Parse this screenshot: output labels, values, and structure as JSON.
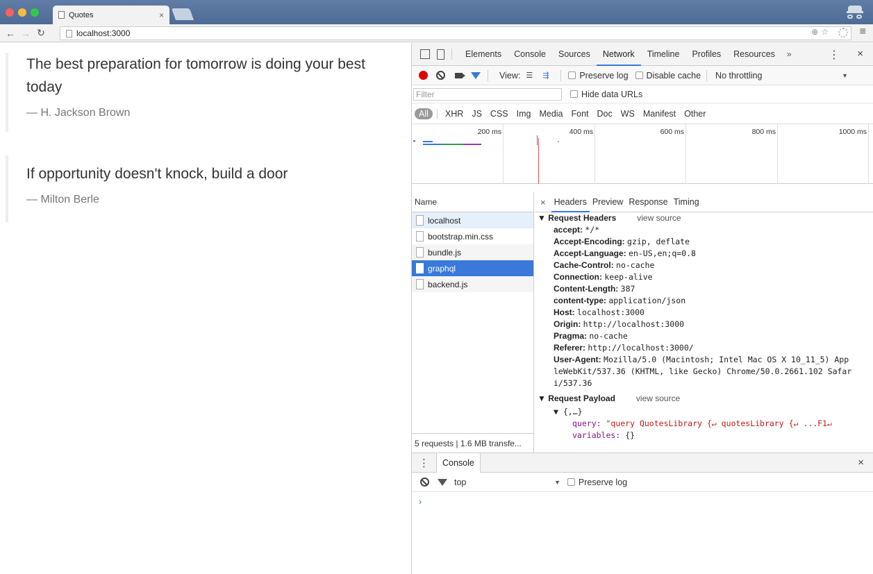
{
  "browser": {
    "tab_title": "Quotes",
    "tab_close": "×",
    "url": "localhost:3000",
    "omnibox_icons": "⊕☆",
    "menu": "≡"
  },
  "page": {
    "quotes": [
      {
        "text": "The best preparation for tomorrow is doing your best today",
        "author": "— H. Jackson Brown"
      },
      {
        "text": "If opportunity doesn't knock, build a door",
        "author": "— Milton Berle"
      }
    ]
  },
  "devtools": {
    "tabs": [
      "Elements",
      "Console",
      "Sources",
      "Network",
      "Timeline",
      "Profiles",
      "Resources"
    ],
    "active_tab": "Network",
    "more": "»",
    "kebab": "⋮",
    "close": "×",
    "network": {
      "view_label": "View:",
      "preserve_log": "Preserve log",
      "disable_cache": "Disable cache",
      "throttling": "No throttling",
      "filter_placeholder": "Filter",
      "hide_data_urls": "Hide data URLs",
      "types": [
        "All",
        "XHR",
        "JS",
        "CSS",
        "Img",
        "Media",
        "Font",
        "Doc",
        "WS",
        "Manifest",
        "Other"
      ],
      "timeline_labels": [
        "200 ms",
        "400 ms",
        "600 ms",
        "800 ms",
        "1000 ms"
      ],
      "name_header": "Name",
      "requests": [
        "localhost",
        "bootstrap.min.css",
        "bundle.js",
        "graphql",
        "backend.js"
      ],
      "selected_request": "graphql",
      "status": "5 requests  |  1.6 MB transfe..."
    },
    "details": {
      "close": "×",
      "tabs": [
        "Headers",
        "Preview",
        "Response",
        "Timing"
      ],
      "active_tab": "Headers",
      "request_headers_title": "▼ Request Headers",
      "view_source": "view source",
      "headers": [
        {
          "k": "accept:",
          "v": "*/*"
        },
        {
          "k": "Accept-Encoding:",
          "v": "gzip, deflate"
        },
        {
          "k": "Accept-Language:",
          "v": "en-US,en;q=0.8"
        },
        {
          "k": "Cache-Control:",
          "v": "no-cache"
        },
        {
          "k": "Connection:",
          "v": "keep-alive"
        },
        {
          "k": "Content-Length:",
          "v": "387"
        },
        {
          "k": "content-type:",
          "v": "application/json"
        },
        {
          "k": "Host:",
          "v": "localhost:3000"
        },
        {
          "k": "Origin:",
          "v": "http://localhost:3000"
        },
        {
          "k": "Pragma:",
          "v": "no-cache"
        },
        {
          "k": "Referer:",
          "v": "http://localhost:3000/"
        },
        {
          "k": "User-Agent:",
          "v": "Mozilla/5.0 (Macintosh; Intel Mac OS X 10_11_5) App"
        }
      ],
      "user_agent_cont": [
        "leWebKit/537.36 (KHTML, like Gecko) Chrome/50.0.2661.102 Safar",
        "i/537.36"
      ],
      "request_payload_title": "▼ Request Payload",
      "payload_root": "▼ {,…}",
      "payload_query_key": "query:",
      "payload_query_val": "\"query QuotesLibrary {↵  quotesLibrary {↵    ...F1↵",
      "payload_vars_key": "variables:",
      "payload_vars_val": "{}"
    },
    "console": {
      "tab": "Console",
      "context": "top",
      "preserve_log": "Preserve log",
      "prompt": "›",
      "close": "×",
      "kebab": "⋮"
    }
  }
}
